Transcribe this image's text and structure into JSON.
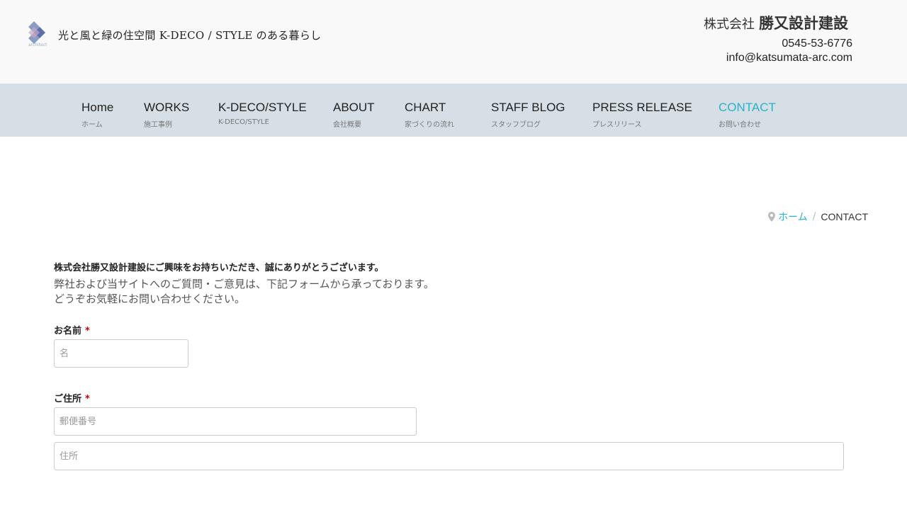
{
  "header": {
    "tagline": "光と風と緑の住空間 K-DECO / STYLE のある暮らし",
    "company_prefix": "株式会社",
    "company_name": "勝又設計建設",
    "phone": "0545-53-6776",
    "email": "info@katsumata-arc.com"
  },
  "nav": {
    "items": [
      {
        "en": "Home",
        "jp": "ホーム"
      },
      {
        "en": "WORKS",
        "jp": "施工事例"
      },
      {
        "en": "K-DECO/STYLE",
        "jp": "K-DECO/STYLE"
      },
      {
        "en": "ABOUT",
        "jp": "会社概要"
      },
      {
        "en": "CHART",
        "jp": "家づくりの流れ"
      },
      {
        "en": "STAFF BLOG",
        "jp": "スタッフブログ"
      },
      {
        "en": "PRESS RELEASE",
        "jp": "プレスリリース"
      },
      {
        "en": "CONTACT",
        "jp": "お問い合わせ"
      }
    ],
    "active": "CONTACT",
    "active_color": "#2bb0cc"
  },
  "breadcrumb": {
    "home": "ホーム",
    "separator": "/",
    "current": "CONTACT"
  },
  "intro": {
    "bold": "株式会社勝又設計建設にご興味をお持ちいただき、誠にありがとうございます。",
    "line1": "弊社および当サイトへのご質問・ご意見は、下記フォームから承っております。",
    "line2": "どうぞお気軽にお問い合わせください。"
  },
  "form": {
    "name_label": "お名前",
    "name_placeholder": "名",
    "address_label": "ご住所",
    "postal_placeholder": "郵便番号",
    "address_placeholder": "住所",
    "required_mark": "*"
  }
}
